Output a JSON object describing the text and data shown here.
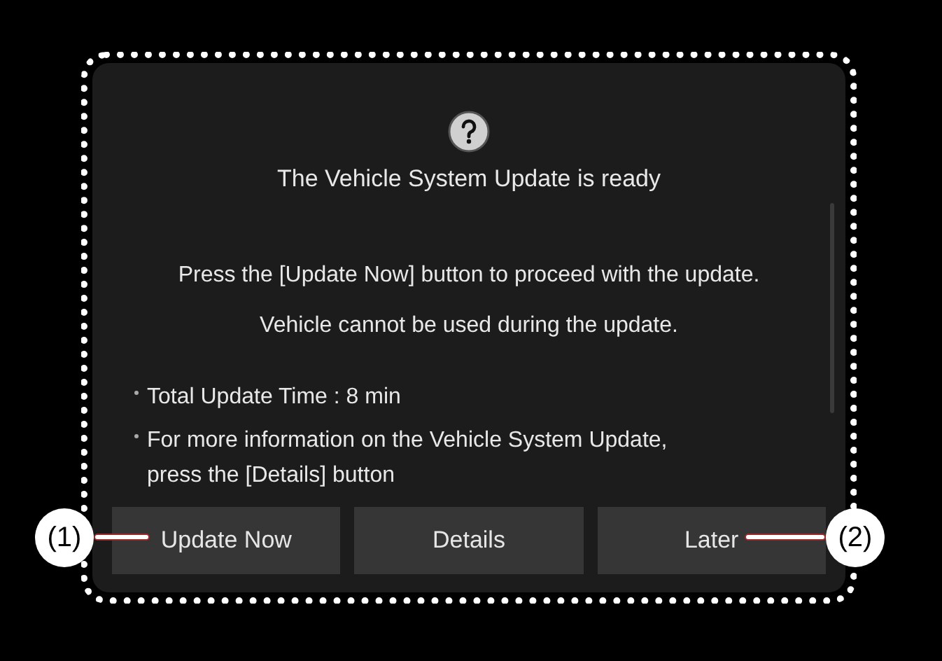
{
  "dialog": {
    "title": "The Vehicle System Update is ready",
    "messages": [
      "Press the [Update Now] button to proceed with the update.",
      "Vehicle cannot be used during the update."
    ],
    "bullets": [
      "Total Update Time : 8 min",
      "For more information on the Vehicle System Update, press the [Details] button"
    ],
    "buttons": [
      "Update Now",
      "Details",
      "Later"
    ]
  },
  "callouts": [
    {
      "label": "(1)",
      "kind": "left"
    },
    {
      "label": "(2)",
      "kind": "right"
    }
  ]
}
